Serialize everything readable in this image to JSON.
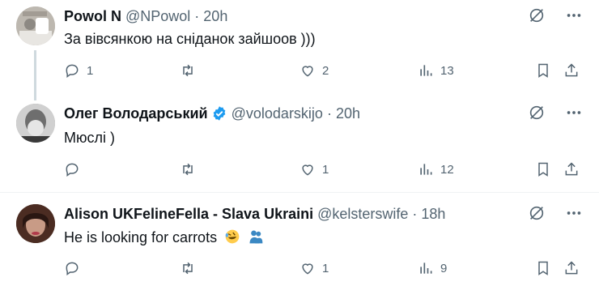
{
  "tweets": [
    {
      "name": "Powol N",
      "handle": "@NPowol",
      "dot": "·",
      "time": "20h",
      "text": "За вівсянкою на сніданок зайшоов )))",
      "replies": "1",
      "retweets": "",
      "likes": "2",
      "views": "13"
    },
    {
      "name": "Олег Володарський",
      "handle": "@volodarskijo",
      "dot": "·",
      "time": "20h",
      "verified": true,
      "text": "Мюслі )",
      "replies": "",
      "retweets": "",
      "likes": "1",
      "views": "12"
    },
    {
      "name": "Alison UKFelineFella - Slava Ukraini",
      "handle": "@kelsterswife",
      "dot": "·",
      "time": "18h",
      "text": "He is looking for carrots",
      "emojis": [
        "rofl-emoji",
        "people-hugging-emoji"
      ],
      "replies": "",
      "retweets": "",
      "likes": "1",
      "views": "9"
    }
  ],
  "icons": {
    "grok": "grok-slash-icon",
    "more": "more-dots-icon",
    "reply": "reply-icon",
    "retweet": "retweet-icon",
    "like": "heart-icon",
    "views": "views-bar-icon",
    "bookmark": "bookmark-icon",
    "share": "share-icon"
  },
  "colors": {
    "text": "#0f1419",
    "secondary": "#536471",
    "verified": "#1d9bf0",
    "divider": "#eff3f4"
  }
}
